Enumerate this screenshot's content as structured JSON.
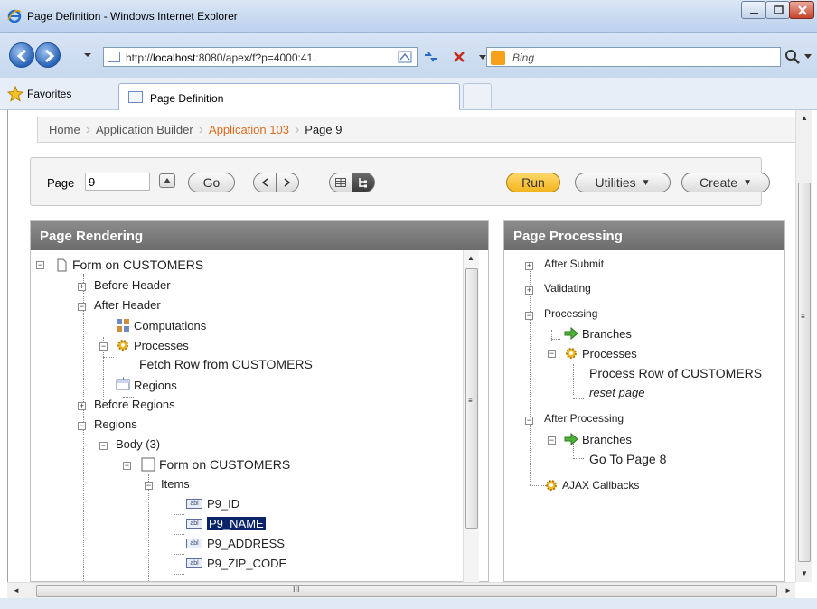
{
  "window": {
    "title": "Page Definition - Windows Internet Explorer"
  },
  "address": {
    "url_prefix": "http://",
    "url_host": "localhost",
    "url_rest": ":8080/apex/f?p=4000:41."
  },
  "search": {
    "placeholder": "Bing"
  },
  "favorites": {
    "label": "Favorites",
    "tab_label": "Page Definition"
  },
  "breadcrumb": {
    "items": [
      "Home",
      "Application Builder",
      "Application 103",
      "Page 9"
    ]
  },
  "toolbar": {
    "page_label": "Page",
    "page_value": "9",
    "go_label": "Go",
    "run_label": "Run",
    "utilities_label": "Utilities",
    "create_label": "Create"
  },
  "rendering": {
    "title": "Page Rendering",
    "nodes": [
      "Form on CUSTOMERS",
      "Before Header",
      "After Header",
      "Computations",
      "Processes",
      "Fetch Row from CUSTOMERS",
      "Regions",
      "Before Regions",
      "Regions",
      "Body (3)",
      "Form on CUSTOMERS",
      "Items",
      "P9_ID",
      "P9_NAME",
      "P9_ADDRESS",
      "P9_ZIP_CODE"
    ]
  },
  "processing": {
    "title": "Page Processing",
    "nodes": [
      "After Submit",
      "Validating",
      "Processing",
      "Branches",
      "Processes",
      "Process Row of CUSTOMERS",
      "reset page",
      "After Processing",
      "Branches",
      "Go To Page 8",
      "AJAX Callbacks"
    ]
  },
  "colors": {
    "accent": "#e06b1c",
    "panel_header": "#7c7c7c",
    "selection": "#0a246a",
    "run_button": "#f2b51e"
  },
  "icons": {
    "item_badge": "abl"
  }
}
